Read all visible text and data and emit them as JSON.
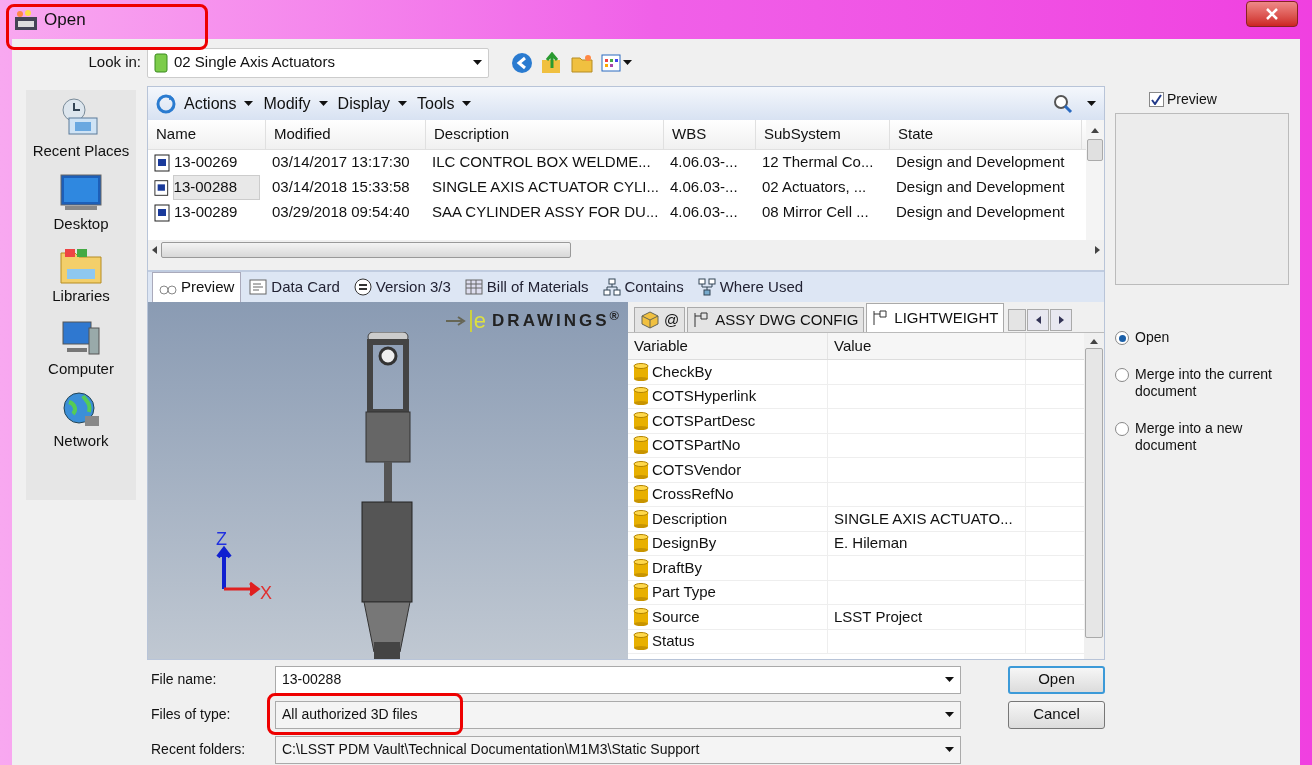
{
  "window": {
    "title": "Open",
    "highlighted": true
  },
  "look_in": {
    "label": "Look in:",
    "value": "02 Single Axis Actuators"
  },
  "places": [
    {
      "label": "Recent Places",
      "kind": "recent"
    },
    {
      "label": "Desktop",
      "kind": "desktop"
    },
    {
      "label": "Libraries",
      "kind": "libraries"
    },
    {
      "label": "Computer",
      "kind": "computer"
    },
    {
      "label": "Network",
      "kind": "network"
    }
  ],
  "toolbar": {
    "menus": [
      "Actions",
      "Modify",
      "Display",
      "Tools"
    ]
  },
  "file_table": {
    "columns": [
      "Name",
      "Modified",
      "Description",
      "WBS",
      "SubSystem",
      "State"
    ],
    "rows": [
      {
        "cells": [
          "13-00269",
          "03/14/2017 13:17:30",
          "ILC CONTROL BOX WELDME...",
          "4.06.03-...",
          "12 Thermal Co...",
          "Design and Development"
        ],
        "selected": false
      },
      {
        "cells": [
          "13-00288",
          "03/14/2018 15:33:58",
          "SINGLE AXIS ACTUATOR CYLI...",
          "4.06.03-...",
          "02 Actuators, ...",
          "Design and Development"
        ],
        "selected": true
      },
      {
        "cells": [
          "13-00289",
          "03/29/2018 09:54:40",
          "SAA CYLINDER ASSY FOR DU...",
          "4.06.03-...",
          "08 Mirror Cell ...",
          "Design and Development"
        ],
        "selected": false
      }
    ]
  },
  "preview_tabs": [
    {
      "label": "Preview",
      "kind": "preview",
      "selected": true
    },
    {
      "label": "Data Card",
      "kind": "card",
      "selected": false
    },
    {
      "label": "Version 3/3",
      "kind": "version",
      "selected": false
    },
    {
      "label": "Bill of Materials",
      "kind": "bom",
      "selected": false
    },
    {
      "label": "Contains",
      "kind": "tree",
      "selected": false
    },
    {
      "label": "Where Used",
      "kind": "used",
      "selected": false
    }
  ],
  "viewer": {
    "logo_letter": "e",
    "logo_text": "DRAWINGS$^{®}$",
    "axis_z": "Z",
    "axis_x": "X"
  },
  "config_tabs": [
    {
      "label": "@",
      "kind": "part",
      "selected": false
    },
    {
      "label": "ASSY DWG CONFIG",
      "kind": "config",
      "selected": false
    },
    {
      "label": "LIGHTWEIGHT",
      "kind": "config",
      "selected": true
    }
  ],
  "variables": {
    "columns": [
      "Variable",
      "Value"
    ],
    "rows": [
      {
        "variable": "CheckBy"
      },
      {
        "variable": "COTSHyperlink"
      },
      {
        "variable": "COTSPartDesc"
      },
      {
        "variable": "COTSPartNo"
      },
      {
        "variable": "COTSVendor"
      },
      {
        "variable": "CrossRefNo"
      },
      {
        "variable": "Description",
        "value": "SINGLE AXIS ACTUATO..."
      },
      {
        "variable": "DesignBy",
        "value": "E. Hileman"
      },
      {
        "variable": "DraftBy"
      },
      {
        "variable": "Part Type"
      },
      {
        "variable": "Source",
        "value": "LSST Project"
      },
      {
        "variable": "Status"
      }
    ]
  },
  "preview_checkbox": {
    "label": "Preview",
    "checked": true
  },
  "options": [
    {
      "label": "Open",
      "selected": true
    },
    {
      "label": "Merge into the current document",
      "selected": false
    },
    {
      "label": "Merge into a new document",
      "selected": false
    }
  ],
  "fields": [
    {
      "label": "File name:",
      "value": "13-00288",
      "highlighted": false
    },
    {
      "label": "Files of type:",
      "value": "All authorized 3D files",
      "highlighted": true
    },
    {
      "label": "Recent folders:",
      "value": "C:\\LSST PDM Vault\\Technical Documentation\\M1M3\\Static Support",
      "highlighted": false
    }
  ],
  "buttons": [
    {
      "label": "Open",
      "default": true
    },
    {
      "label": "Cancel",
      "default": false
    }
  ]
}
